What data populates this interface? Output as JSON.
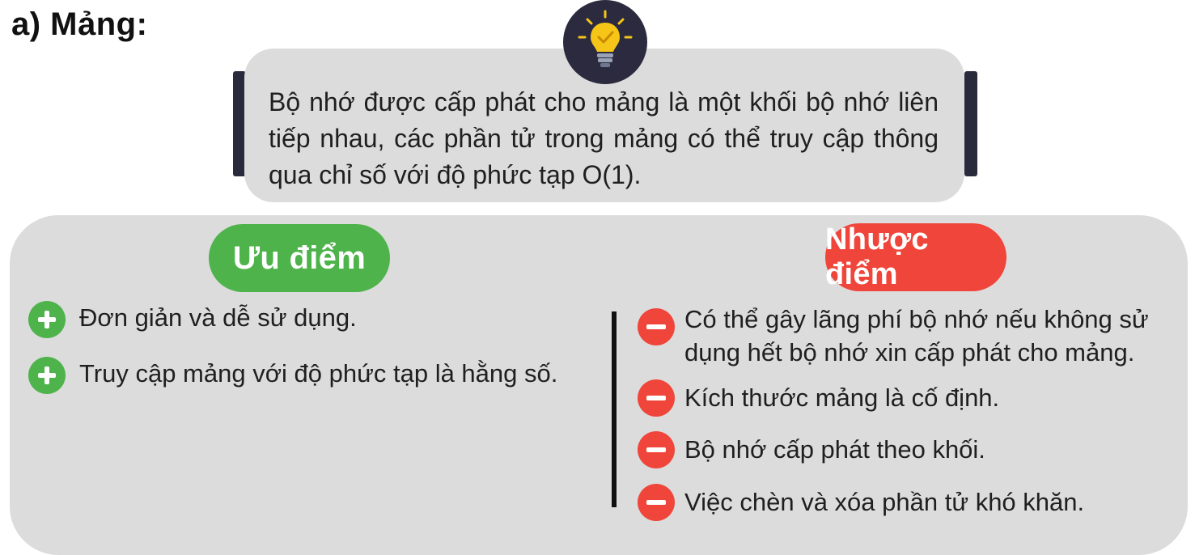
{
  "heading": "a) Mảng:",
  "definition": "Bộ nhớ được cấp phát cho mảng là một khối bộ nhớ liên tiếp nhau, các phần tử trong mảng có thể truy cập thông qua chỉ số với độ phức tạp O(1).",
  "pros": {
    "title": "Ưu điểm",
    "items": [
      "Đơn giản và dễ sử dụng.",
      "Truy cập mảng với độ phức tạp là hằng số."
    ]
  },
  "cons": {
    "title": "Nhược điểm",
    "items": [
      "Có thể gây lãng phí bộ nhớ nếu không sử dụng hết bộ nhớ xin cấp phát cho mảng.",
      "Kích thước mảng là cố định.",
      "Bộ nhớ cấp phát theo khối.",
      "Việc chèn và xóa phần tử khó khăn."
    ]
  },
  "colors": {
    "pros": "#4db34a",
    "cons": "#f0453a",
    "panel": "#dcdcdc",
    "dark": "#2b2a3f",
    "bulb": "#f5c518"
  },
  "icons": [
    "lightbulb-icon",
    "plus-icon",
    "minus-icon"
  ]
}
